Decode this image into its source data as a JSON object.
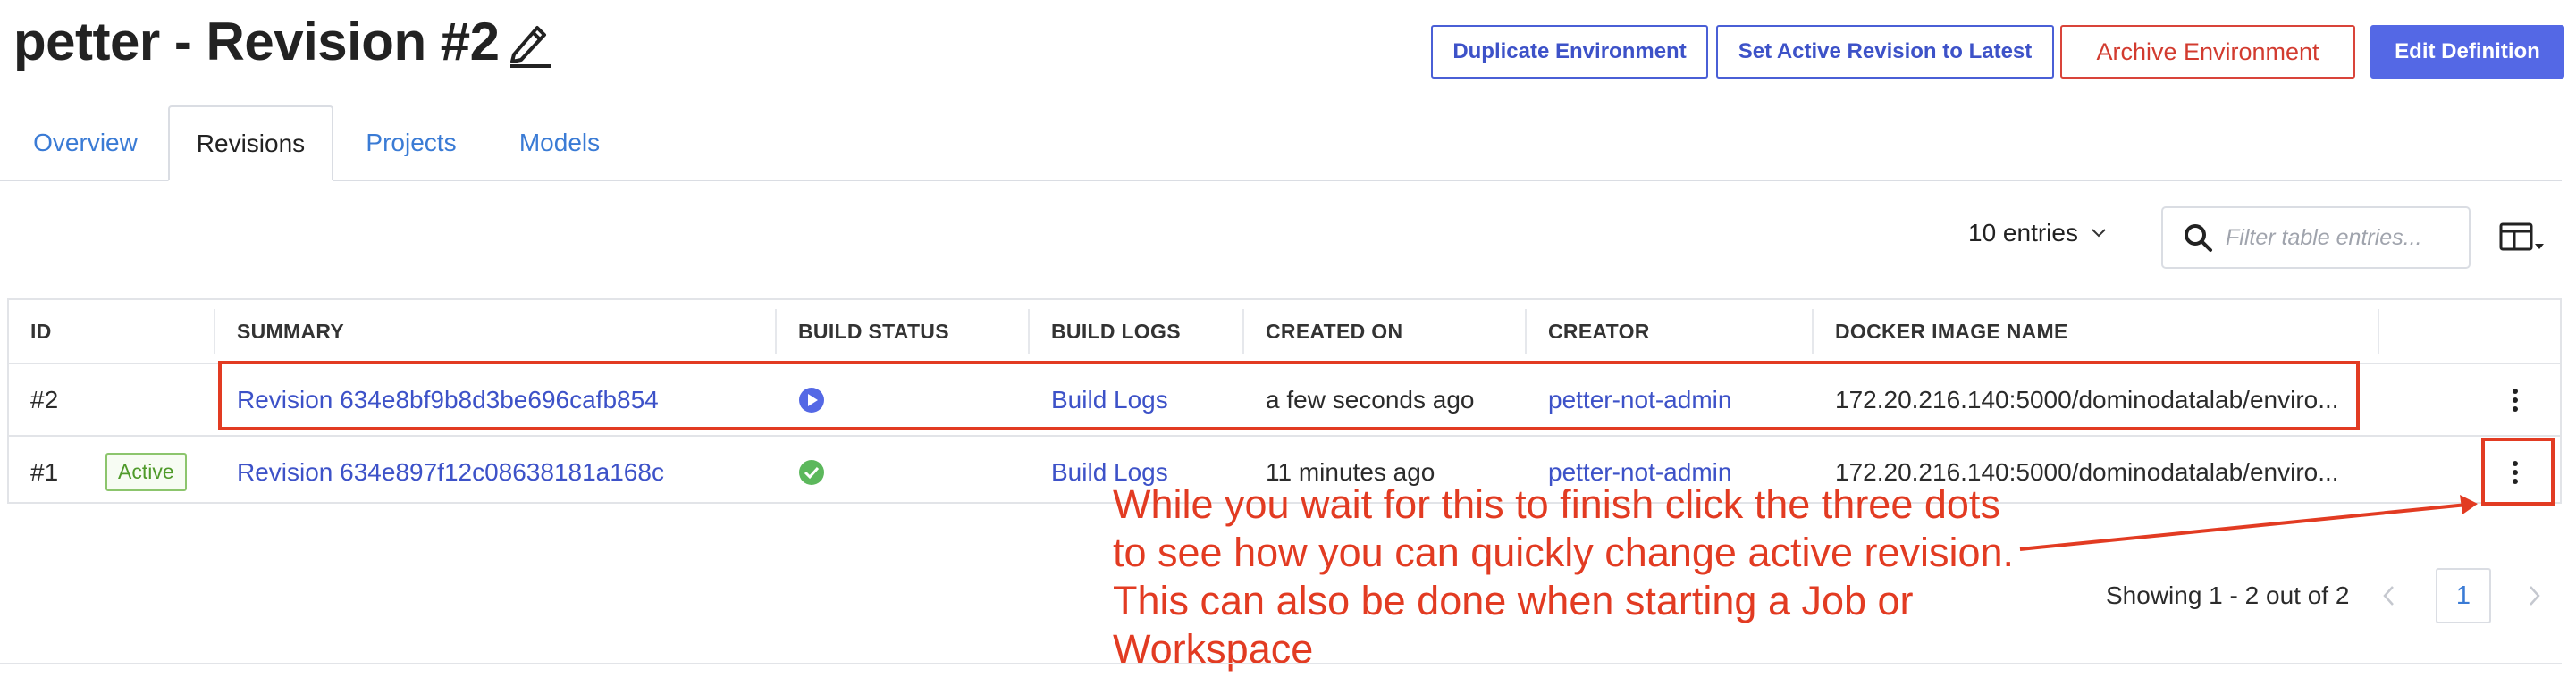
{
  "header": {
    "title": "petter - Revision #2",
    "buttons": {
      "duplicate": "Duplicate Environment",
      "set_active": "Set Active Revision to Latest",
      "archive": "Archive Environment",
      "edit": "Edit Definition"
    }
  },
  "tabs": [
    {
      "label": "Overview",
      "active": false
    },
    {
      "label": "Revisions",
      "active": true
    },
    {
      "label": "Projects",
      "active": false
    },
    {
      "label": "Models",
      "active": false
    }
  ],
  "toolbar": {
    "entries": "10 entries",
    "filter_placeholder": "Filter table entries..."
  },
  "table": {
    "headers": [
      "ID",
      "SUMMARY",
      "BUILD STATUS",
      "BUILD LOGS",
      "CREATED ON",
      "CREATOR",
      "DOCKER IMAGE NAME"
    ],
    "rows": [
      {
        "id": "#2",
        "badge": "",
        "summary": "Revision 634e8bf9b8d3be696cafb854",
        "build_status": "building",
        "build_logs": "Build Logs",
        "created_on": "a few seconds ago",
        "creator": "petter-not-admin",
        "docker_image": "172.20.216.140:5000/dominodatalab/enviro..."
      },
      {
        "id": "#1",
        "badge": "Active",
        "summary": "Revision 634e897f12c08638181a168c",
        "build_status": "succeeded",
        "build_logs": "Build Logs",
        "created_on": "11 minutes ago",
        "creator": "petter-not-admin",
        "docker_image": "172.20.216.140:5000/dominodatalab/enviro..."
      }
    ]
  },
  "annotation": {
    "lines": [
      "While you wait for this to finish click the three dots",
      "to see how you can quickly change active revision.",
      "This can also be done when starting a Job or",
      "Workspace"
    ]
  },
  "pagination": {
    "showing": "Showing 1 - 2 out of 2",
    "current_page": "1"
  },
  "colors": {
    "accent": "#5468e5",
    "link": "#3d52c8",
    "danger": "#d23b2f",
    "annotation": "#e23b22",
    "success": "#5cb85c"
  }
}
